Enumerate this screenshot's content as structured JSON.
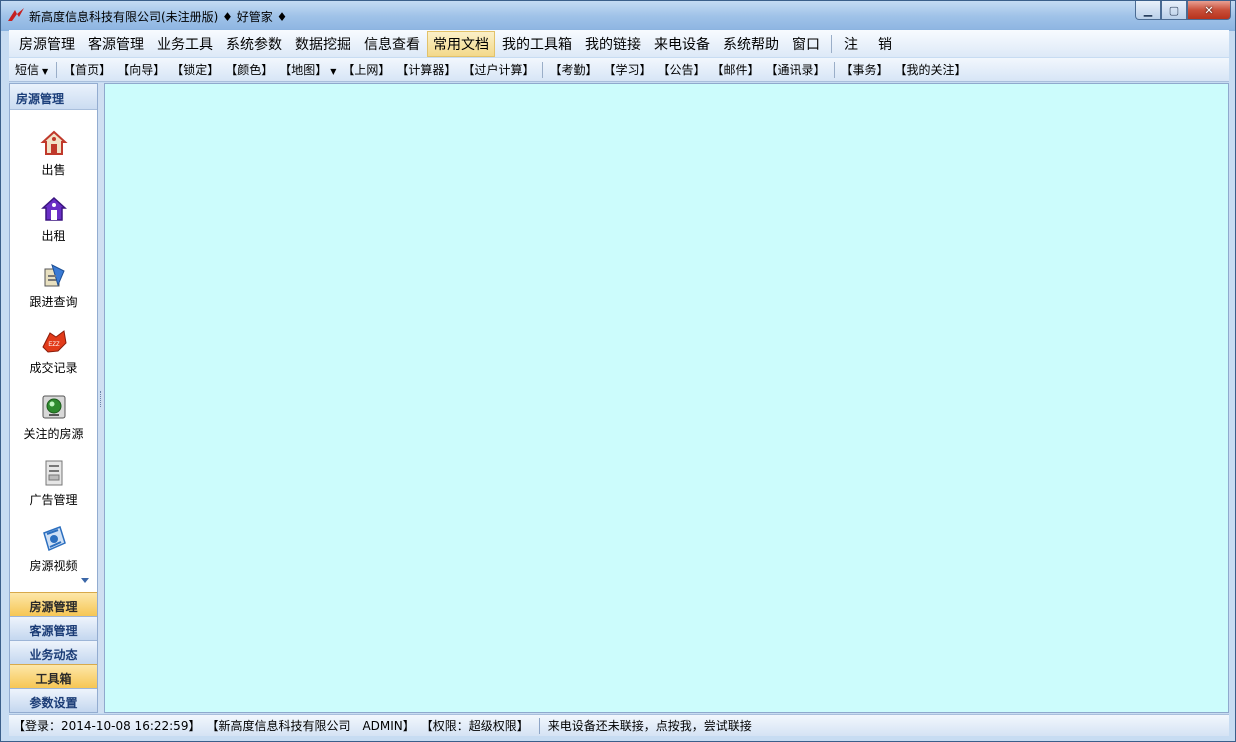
{
  "window": {
    "title": "新高度信息科技有限公司(未注册版) ♦ 好管家 ♦"
  },
  "menu": {
    "items": [
      "房源管理",
      "客源管理",
      "业务工具",
      "系统参数",
      "数据挖掘",
      "信息查看",
      "常用文档",
      "我的工具箱",
      "我的链接",
      "来电设备",
      "系统帮助",
      "窗口"
    ],
    "active": "常用文档",
    "extra": [
      "注",
      "销"
    ]
  },
  "toolbar": {
    "sms": "短信",
    "group1": [
      "【首页】",
      "【向导】",
      "【锁定】",
      "【颜色】",
      "【地图】",
      "【上网】",
      "【计算器】",
      "【过户计算】"
    ],
    "group2": [
      "【考勤】",
      "【学习】",
      "【公告】",
      "【邮件】",
      "【通讯录】"
    ],
    "group3": [
      "【事务】",
      "【我的关注】"
    ]
  },
  "sidebar": {
    "header": "房源管理",
    "items": [
      {
        "label": "出售",
        "icon": "house-sale-icon",
        "color": "#c0392b"
      },
      {
        "label": "出租",
        "icon": "house-rent-icon",
        "color": "#6a2fc6"
      },
      {
        "label": "跟进查询",
        "icon": "followup-icon",
        "color": "#3a7bd5"
      },
      {
        "label": "成交记录",
        "icon": "deal-record-icon",
        "color": "#e23b1a"
      },
      {
        "label": "关注的房源",
        "icon": "watched-icon",
        "color": "#2e8b2e"
      },
      {
        "label": "广告管理",
        "icon": "ad-icon",
        "color": "#777777"
      },
      {
        "label": "房源视频",
        "icon": "video-icon",
        "color": "#2c6fbf"
      }
    ],
    "tabs": [
      {
        "label": "房源管理",
        "highlight": true
      },
      {
        "label": "客源管理",
        "highlight": false
      },
      {
        "label": "业务动态",
        "highlight": false
      },
      {
        "label": "工具箱",
        "highlight": true
      },
      {
        "label": "参数设置",
        "highlight": false
      }
    ]
  },
  "status": {
    "login": "【登录：2014-10-08 16:22:59】",
    "company": "【新高度信息科技有限公司　ADMIN】",
    "rights": "【权限：超级权限】",
    "device": "来电设备还未联接，点按我，尝试联接"
  },
  "colors": {
    "content_bg": "#ccfcfc",
    "accent": "#f6c654"
  }
}
